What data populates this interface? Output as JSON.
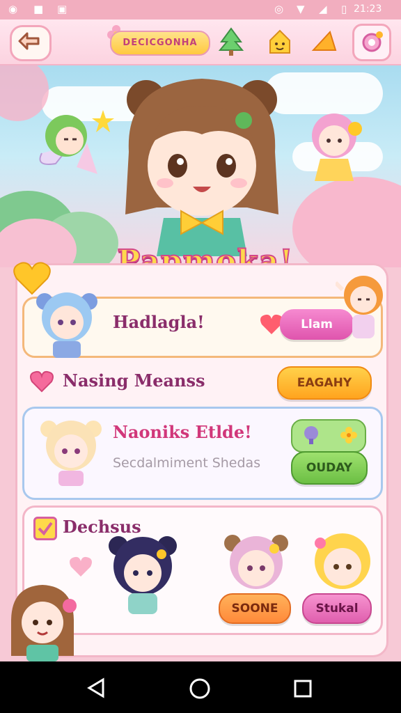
{
  "status_bar": {
    "time": "21:23"
  },
  "top_bar": {
    "title": "DECICGONHA"
  },
  "hero": {
    "game_title": "Papmoka!"
  },
  "cards": [
    {
      "label": "Hadlagla!",
      "button": "Llam"
    },
    {
      "label": "Nasing Meanss",
      "button": "EAGAHY"
    },
    {
      "title": "Naoniks Etlde!",
      "subtitle": "Secdalmiment Shedas",
      "button": "OUDAY"
    },
    {
      "label": "Dechsus",
      "buttons": [
        "SOONE",
        "Stukal"
      ]
    }
  ],
  "colors": {
    "pink": "#e85fab",
    "orange": "#ffa41f",
    "green": "#7bc453",
    "title_stroke": "#d2468a"
  }
}
